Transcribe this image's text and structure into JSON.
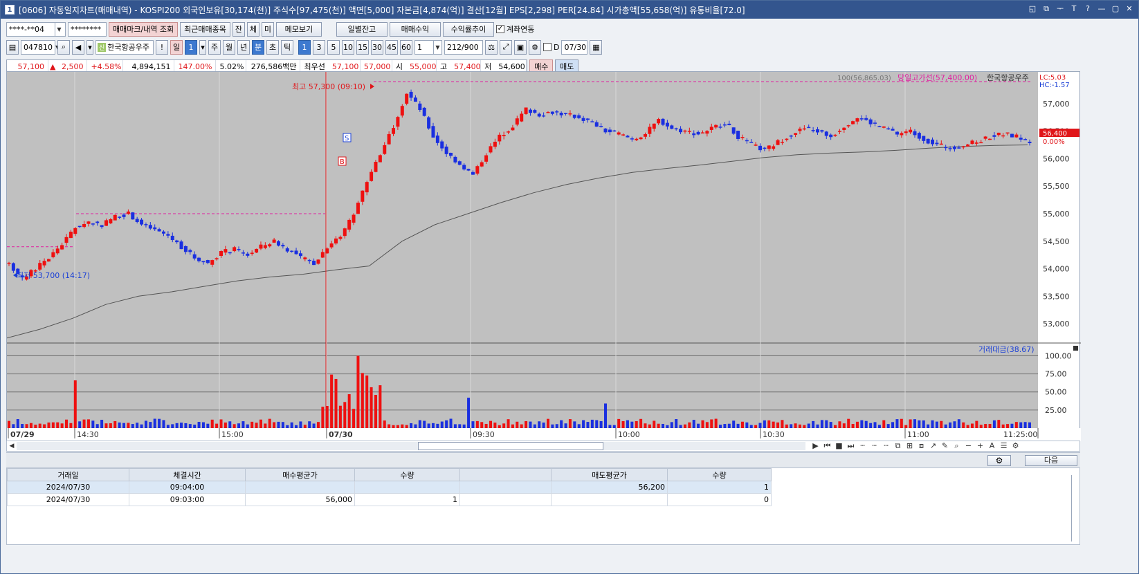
{
  "window": {
    "app_icon": "1",
    "title": "[0606] 자동일지차트(매매내역) - KOSPI200 외국인보유[30,174(천)] 주식수[97,475(천)] 액면[5,000] 자본금[4,874(억)] 결산[12월] EPS[2,298] PER[24.84] 시가총액[55,658(억)] 유통비율[72.0]",
    "controls": [
      "◱",
      "⧉",
      "ᅮ",
      "T",
      "?",
      "—",
      "▢",
      "✕"
    ]
  },
  "toolbar1": {
    "account": "****-**04",
    "password": "********",
    "btn_trade_mark": "매매마크/내역 조회",
    "btn_recent": "최근매매종목",
    "btn_jan": "잔",
    "btn_che": "체",
    "btn_mi": "미",
    "btn_memo": "메모보기",
    "btn_daily_balance": "일별잔고",
    "btn_trade_profit": "매매수익",
    "btn_profit_trend": "수익률추이",
    "link_checkbox": "계좌연동"
  },
  "toolbar2": {
    "code": "047810",
    "market_badge": "신",
    "stock_name": "한국항공우주",
    "btn_excl": "!",
    "period_day": "일",
    "period_val": "1",
    "periods": [
      "주",
      "월",
      "년",
      "분",
      "초",
      "틱"
    ],
    "intervals": [
      "1",
      "3",
      "5",
      "10",
      "15",
      "30",
      "45",
      "60"
    ],
    "interval_select": "1",
    "count": "212",
    "count_total": "/900",
    "date_check": "D",
    "date": "07/30"
  },
  "quote": {
    "price": "57,100",
    "arrow": "▲",
    "change": "2,500",
    "rate": "+4.58%",
    "volume": "4,894,151",
    "vol_ratio": "147.00%",
    "turnover": "5.02%",
    "amount": "276,586백만",
    "best_label": "최우선",
    "ask": "57,100",
    "bid": "57,000",
    "open_label": "시",
    "open": "55,000",
    "high_label": "고",
    "high": "57,400",
    "low_label": "저",
    "low": "54,600",
    "buy_btn": "매수",
    "sell_btn": "매도"
  },
  "chart_labels": {
    "ma_legend": "100(56,865.03)",
    "high_line_legend": "당일고가선(57,400.00)",
    "stock_legend": "한국항공우주",
    "lc": "LC:5.03",
    "hc": "HC:-1.57",
    "cur_price_tag": "56,400",
    "cur_rate": "0.00%",
    "max_label": "최고 57,300 (09:10)",
    "min_label": "최저 53,700 (14:17)",
    "volume_legend": "거래대금(38.67)",
    "marker_s": "S",
    "marker_b": "B"
  },
  "chart_data": {
    "type": "candlestick",
    "title": "",
    "price_axis": {
      "ticks": [
        "57,000",
        "56,500",
        "56,000",
        "55,500",
        "55,000",
        "54,500",
        "54,000",
        "53,500",
        "53,000"
      ],
      "ylim": [
        52700,
        57500
      ]
    },
    "volume_axis": {
      "ticks": [
        "100.00",
        "75.00",
        "50.00",
        "25.00"
      ],
      "ylim": [
        0,
        110
      ]
    },
    "x_ticks": [
      "07/29",
      "14:30",
      "15:00",
      "07/30",
      "09:30",
      "10:00",
      "10:30",
      "11:00",
      "11:25:00"
    ],
    "reference_lines": {
      "day_high": 57400,
      "prev_high": 55000,
      "prev_high_left": 54400
    },
    "ma100": [
      52740,
      52900,
      53100,
      53350,
      53500,
      53580,
      53680,
      53780,
      53850,
      53900,
      53980,
      54050,
      54500,
      54800,
      55000,
      55200,
      55380,
      55530,
      55650,
      55750,
      55820,
      55880,
      55950,
      56020,
      56070,
      56100,
      56120,
      56150,
      56190,
      56220,
      56240,
      56250
    ],
    "candle_path": [
      54100,
      53800,
      54000,
      54200,
      54450,
      54750,
      54850,
      54800,
      54950,
      55000,
      54800,
      54700,
      54600,
      54400,
      54200,
      54100,
      54300,
      54350,
      54250,
      54400,
      54500,
      54350,
      54200,
      54100,
      54400,
      54600,
      55000,
      55600,
      56100,
      56600,
      57200,
      56900,
      56400,
      56100,
      55900,
      55700,
      56100,
      56400,
      56600,
      56900,
      56800,
      56850,
      56800,
      56750,
      56650,
      56500,
      56450,
      56350,
      56450,
      56700,
      56550,
      56500,
      56450,
      56550,
      56650,
      56400,
      56250,
      56150,
      56300,
      56450,
      56550,
      56500,
      56400,
      56600,
      56750,
      56650,
      56550,
      56450,
      56500,
      56350,
      56250,
      56200,
      56250,
      56300,
      56400,
      56450,
      56400,
      56300
    ]
  },
  "table": {
    "headers": [
      "거래일",
      "체결시간",
      "매수평균가",
      "수량",
      "",
      "매도평균가",
      "수량"
    ],
    "rows": [
      [
        "2024/07/30",
        "09:04:00",
        "",
        "",
        "",
        "56,200",
        "1"
      ],
      [
        "2024/07/30",
        "09:03:00",
        "56,000",
        "1",
        "",
        "",
        "0"
      ]
    ]
  },
  "bottom": {
    "next_btn": "다음",
    "gear": "⚙"
  }
}
